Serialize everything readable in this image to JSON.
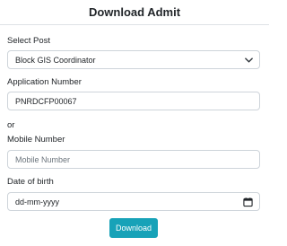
{
  "header": {
    "title": "Download Admit"
  },
  "form": {
    "post": {
      "label": "Select Post",
      "selected": "Block GIS Coordinator"
    },
    "application_number": {
      "label": "Application Number",
      "value": "PNRDCFP00067"
    },
    "or_text": "or",
    "mobile_number": {
      "label": "Mobile Number",
      "placeholder": "Mobile Number"
    },
    "dob": {
      "label": "Date of birth",
      "placeholder": "dd-mm-yyyy"
    },
    "submit_label": "Download"
  },
  "icons": {
    "select": "chevron-down-icon",
    "date": "calendar-icon"
  },
  "colors": {
    "button": "#17a2b8",
    "border": "#ced4da"
  }
}
